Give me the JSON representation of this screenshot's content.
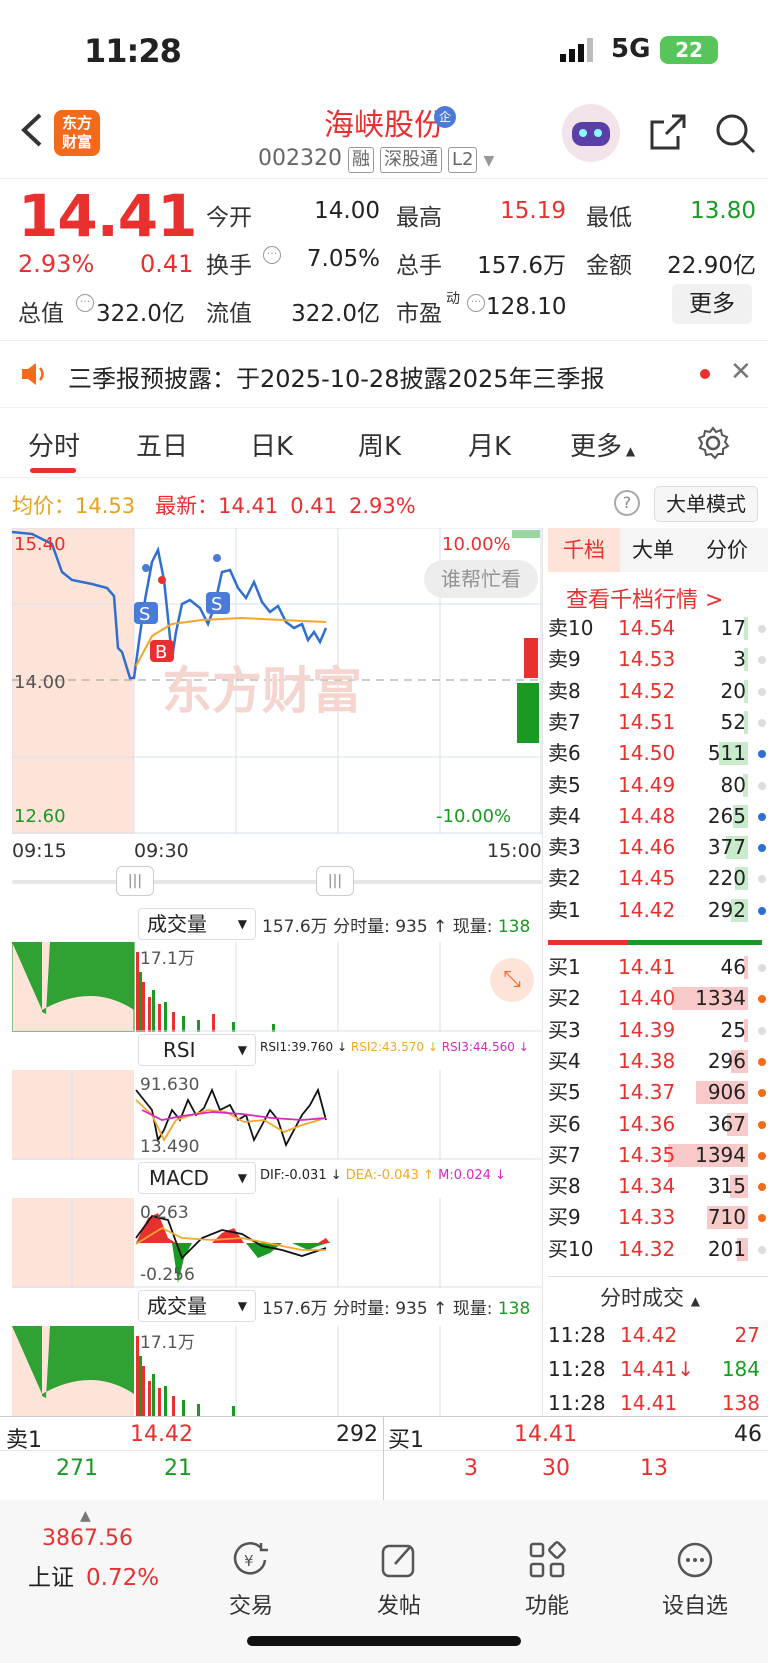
{
  "status": {
    "time": "11:28",
    "network": "5G",
    "battery": "22"
  },
  "header": {
    "title": "海峡股份",
    "code": "002320",
    "tags": [
      "融",
      "深股通",
      "L2"
    ],
    "logo_text": "东方\n财富"
  },
  "quote": {
    "price": "14.41",
    "pct": "2.93%",
    "chg": "0.41",
    "rows": [
      [
        {
          "l": "今开",
          "v": "14.00",
          "c": "#222"
        },
        {
          "l": "最高",
          "v": "15.19",
          "c": "#e8312f"
        },
        {
          "l": "最低",
          "v": "13.80",
          "c": "#1a9a22"
        }
      ],
      [
        {
          "l": "换手",
          "v": "7.05%",
          "c": "#222"
        },
        {
          "l": "总手",
          "v": "157.6万",
          "c": "#222"
        },
        {
          "l": "金额",
          "v": "22.90亿",
          "c": "#222"
        }
      ],
      [
        {
          "l": "流值",
          "v": "322.0亿",
          "c": "#222"
        },
        {
          "l": "市盈",
          "v": "128.10",
          "c": "#222"
        }
      ]
    ],
    "total_label": "总值",
    "total_value": "322.0亿",
    "pe_sup": "动",
    "more": "更多"
  },
  "notice": {
    "text": "三季报预披露：于2025-10-28披露2025年三季报"
  },
  "tabs": [
    "分时",
    "五日",
    "日K",
    "周K",
    "月K",
    "更多"
  ],
  "info": {
    "avg_label": "均价：",
    "avg": "14.53",
    "last_label": "最新：",
    "last": "14.41",
    "chg": "0.41",
    "pct": "2.93%",
    "mode": "大单模式"
  },
  "chart": {
    "high": "15.40",
    "mid": "14.00",
    "low": "12.60",
    "up_pct": "10.00%",
    "down_pct": "-10.00%",
    "t_start": "09:15",
    "t_open": "09:30",
    "t_end": "15:00",
    "watermark": "东方财富",
    "help": "谁帮忙看"
  },
  "vol": {
    "label": "成交量",
    "summary": "157.6万 分时量: 935 ↑ 现量:",
    "now": "138",
    "max": "17.1万"
  },
  "rsi": {
    "label": "RSI",
    "r1": "RSI1:39.760 ↓",
    "r2": "RSI2:43.570 ↓",
    "r3": "RSI3:44.560 ↓",
    "max": "91.630",
    "min": "13.490"
  },
  "macd": {
    "label": "MACD",
    "dif": "DIF:-0.031 ↓",
    "dea": "DEA:-0.043 ↑",
    "m": "M:0.024 ↓",
    "max": "0.263",
    "min": "-0.256"
  },
  "book": {
    "tabs": [
      "千档",
      "大单",
      "分价"
    ],
    "link": "查看千档行情 >",
    "asks": [
      [
        "卖10",
        "14.54",
        "17"
      ],
      [
        "卖9",
        "14.53",
        "3"
      ],
      [
        "卖8",
        "14.52",
        "20"
      ],
      [
        "卖7",
        "14.51",
        "52"
      ],
      [
        "卖6",
        "14.50",
        "511"
      ],
      [
        "卖5",
        "14.49",
        "80"
      ],
      [
        "卖4",
        "14.48",
        "265"
      ],
      [
        "卖3",
        "14.46",
        "377"
      ],
      [
        "卖2",
        "14.45",
        "220"
      ],
      [
        "卖1",
        "14.42",
        "292"
      ]
    ],
    "bids": [
      [
        "买1",
        "14.41",
        "46"
      ],
      [
        "买2",
        "14.40",
        "1334"
      ],
      [
        "买3",
        "14.39",
        "25"
      ],
      [
        "买4",
        "14.38",
        "296"
      ],
      [
        "买5",
        "14.37",
        "906"
      ],
      [
        "买6",
        "14.36",
        "367"
      ],
      [
        "买7",
        "14.35",
        "1394"
      ],
      [
        "买8",
        "14.34",
        "315"
      ],
      [
        "买9",
        "14.33",
        "710"
      ],
      [
        "买10",
        "14.32",
        "201"
      ]
    ],
    "ticks_title": "分时成交",
    "ticks": [
      [
        "11:28",
        "14.42",
        "27"
      ],
      [
        "11:28",
        "14.41↓",
        "184"
      ],
      [
        "11:28",
        "14.41",
        "138"
      ]
    ]
  },
  "summary": {
    "ask_label": "卖1",
    "ask_price": "14.42",
    "ask_vol": "292",
    "bid_label": "买1",
    "bid_price": "14.41",
    "bid_vol": "46",
    "ask_q": [
      "271",
      "21"
    ],
    "bid_q": [
      "3",
      "30",
      "13"
    ]
  },
  "nav": {
    "index_value": "3867.56",
    "index_name": "上证",
    "index_pct": "0.72%",
    "items": [
      "交易",
      "发帖",
      "功能",
      "设自选"
    ]
  }
}
